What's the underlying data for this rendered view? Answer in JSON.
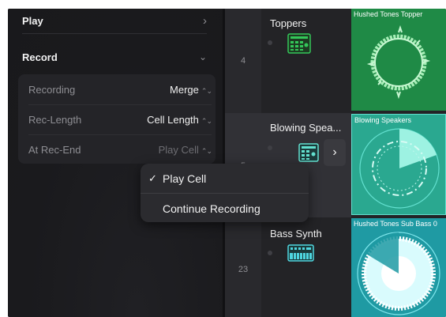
{
  "settings": {
    "play": {
      "label": "Play",
      "chevron": "chevron-right-icon"
    },
    "record": {
      "label": "Record",
      "chevron": "chevron-down-icon"
    },
    "params": [
      {
        "label": "Recording",
        "value": "Merge"
      },
      {
        "label": "Rec-Length",
        "value": "Cell Length"
      },
      {
        "label": "At Rec-End",
        "value": "Play Cell"
      }
    ]
  },
  "menu": {
    "items": [
      {
        "label": "Play Cell",
        "checked": true
      },
      {
        "label": "Continue Recording",
        "checked": false
      }
    ],
    "check_glyph": "✓"
  },
  "tracks": [
    {
      "number": "4",
      "name": "Toppers",
      "icon": "drum-machine-icon",
      "cell_title": "Hushed Tones Topper",
      "cell_color": "#1f8a46"
    },
    {
      "number": "5",
      "name": "Blowing Spea...",
      "icon": "drum-machine-icon",
      "cell_title": "Blowing Speakers",
      "cell_color": "#2aa890"
    },
    {
      "number": "23",
      "name": "Bass Synth",
      "icon": "synth-keyboard-icon",
      "cell_title": "Hushed Tones Sub Bass 0",
      "cell_color": "#1f9aa3"
    }
  ],
  "colors": {
    "accent_green": "#34c759",
    "accent_teal": "#63e0cf",
    "accent_cyan": "#4fd6df"
  }
}
